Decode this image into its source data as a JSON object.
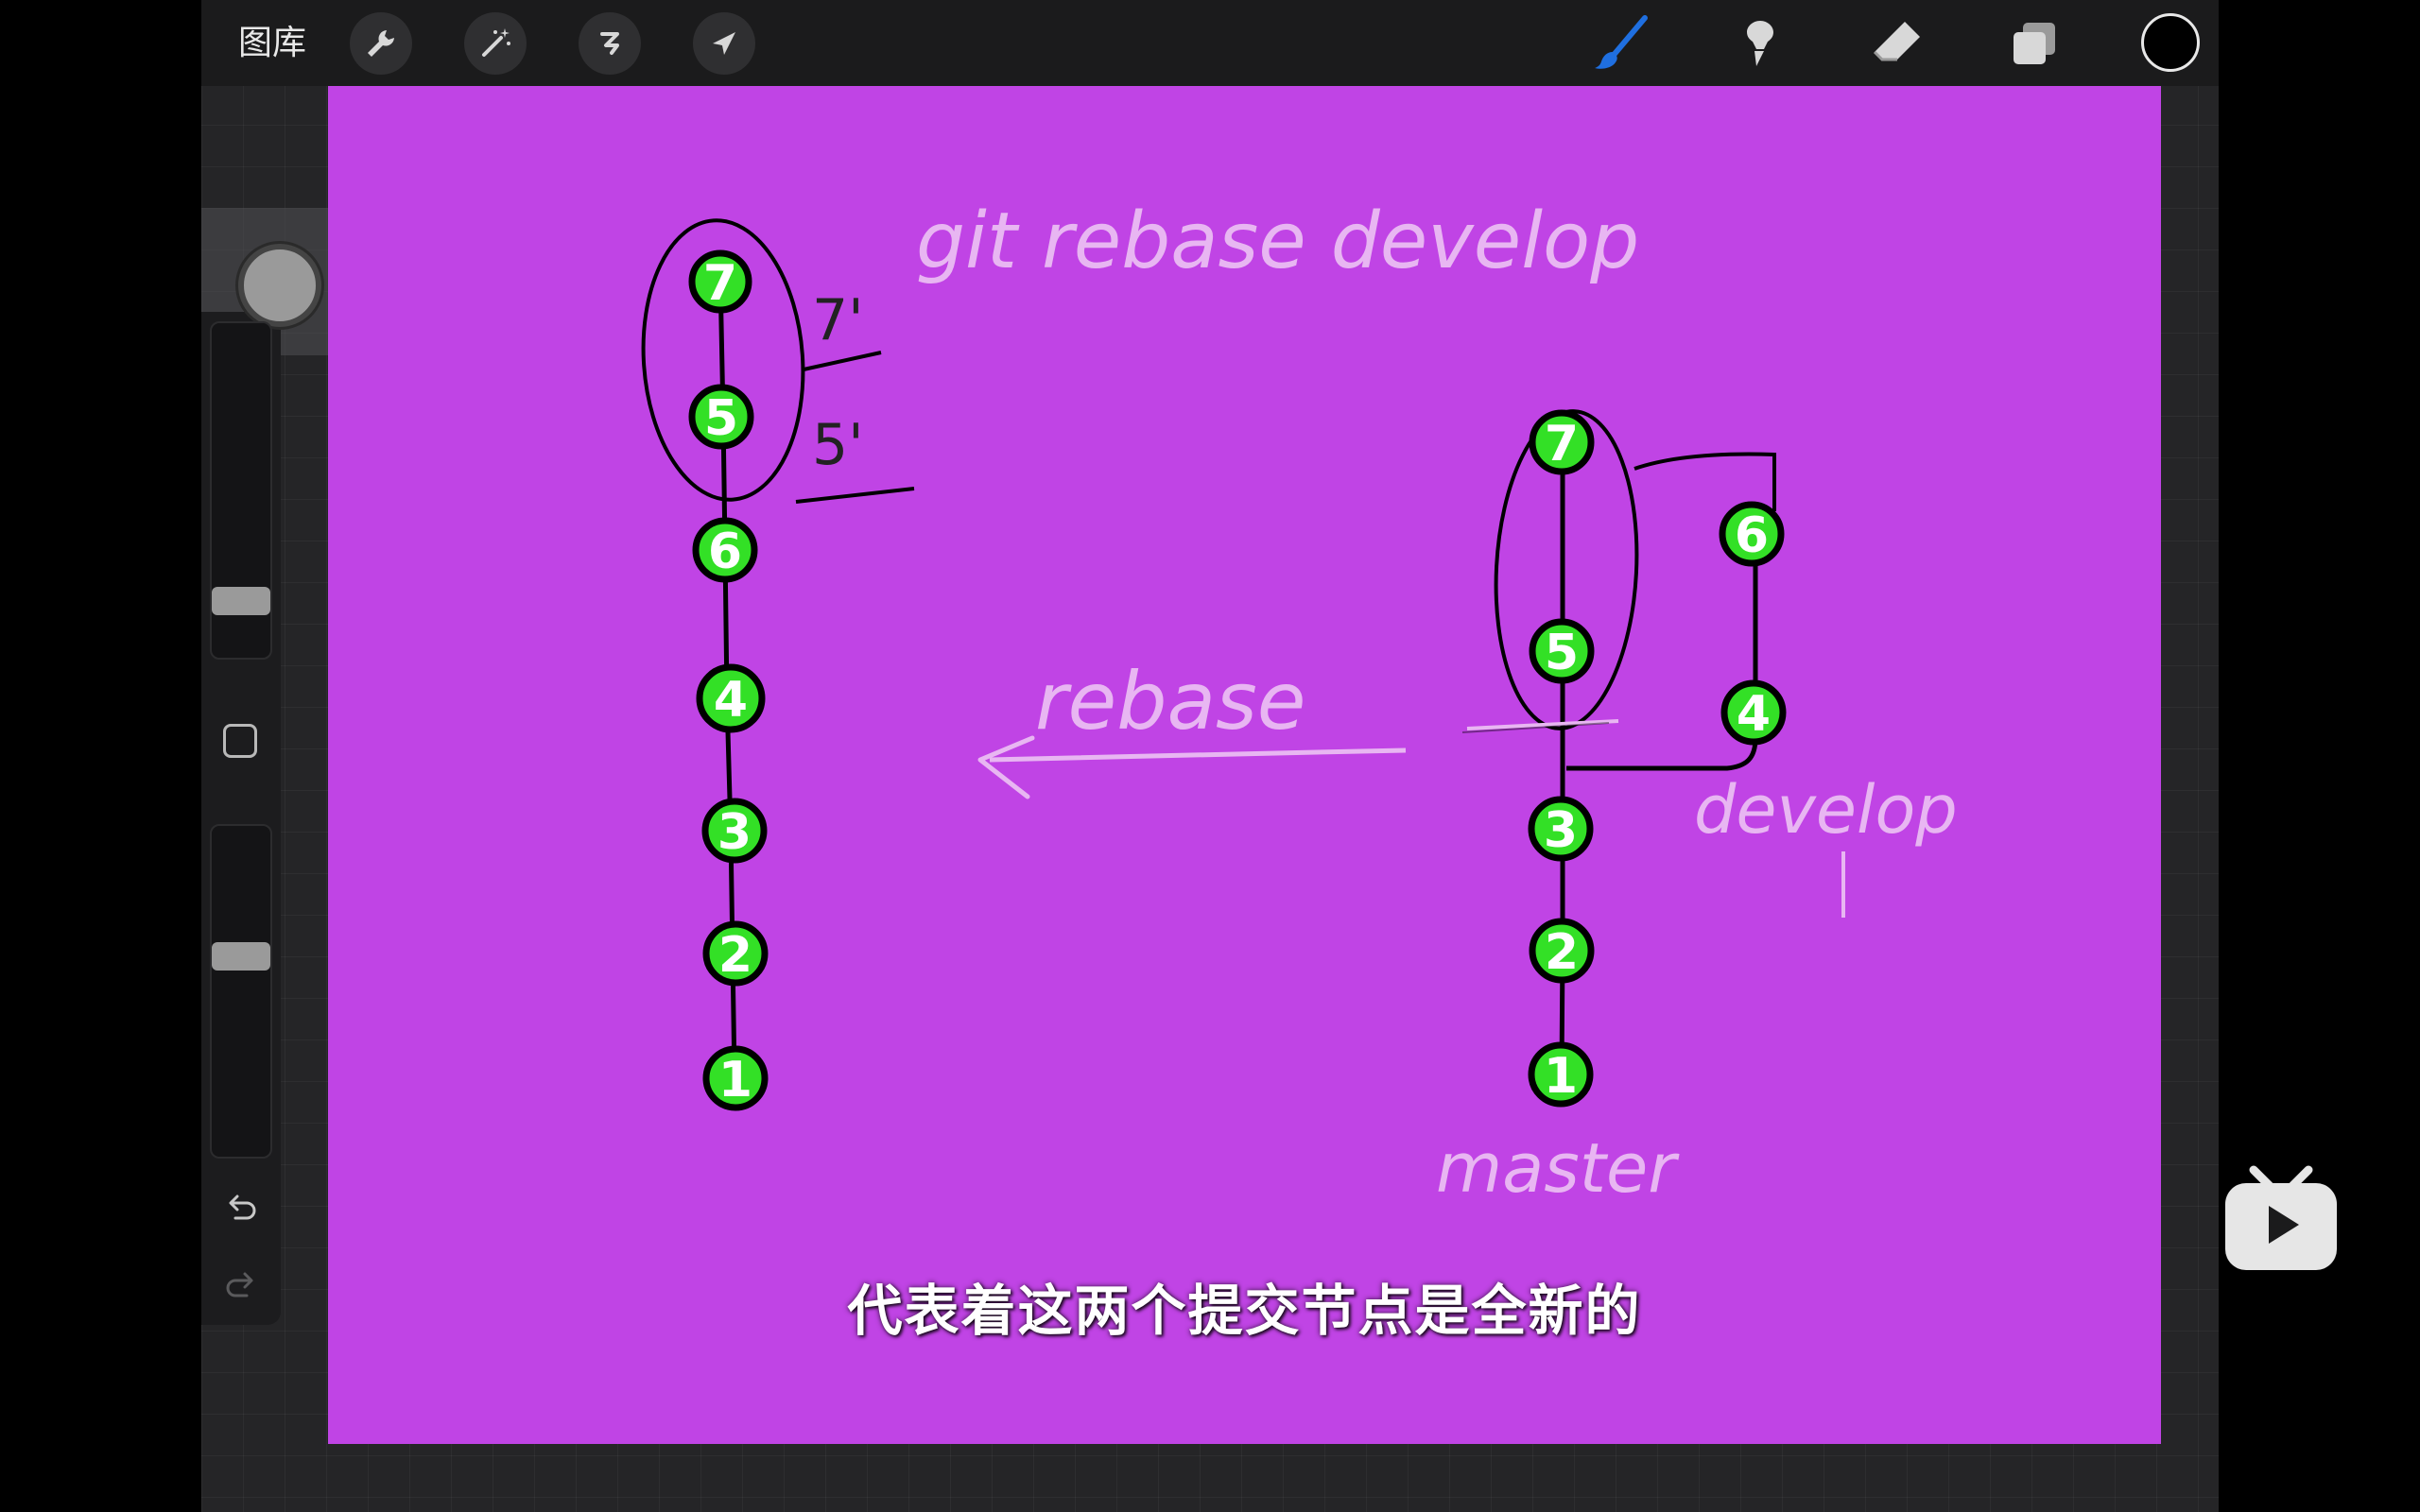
{
  "toolbar": {
    "gallery_label": "图库",
    "left_tools": [
      "wrench-icon",
      "magic-wand-icon",
      "selection-icon",
      "transform-arrow-icon"
    ],
    "right_tools": [
      "brush-icon",
      "smudge-icon",
      "eraser-icon",
      "layers-icon"
    ],
    "current_color": "#000000",
    "brush_color": "#1f6fe0"
  },
  "canvas": {
    "background": "#c044e5",
    "left_branch": {
      "nodes": [
        "1",
        "2",
        "3",
        "4",
        "6",
        "5",
        "7"
      ],
      "rewritten_labels": [
        "7'",
        "5'"
      ]
    },
    "right_master": {
      "nodes": [
        "1",
        "2",
        "3",
        "5",
        "7"
      ],
      "label": "master"
    },
    "right_develop": {
      "nodes": [
        "4",
        "6"
      ],
      "label": "develop"
    },
    "command_text": "git rebase develop",
    "arrow_label": "rebase",
    "node_color": "#33e026"
  },
  "subtitle": "代表着这两个提交节点是全新的"
}
